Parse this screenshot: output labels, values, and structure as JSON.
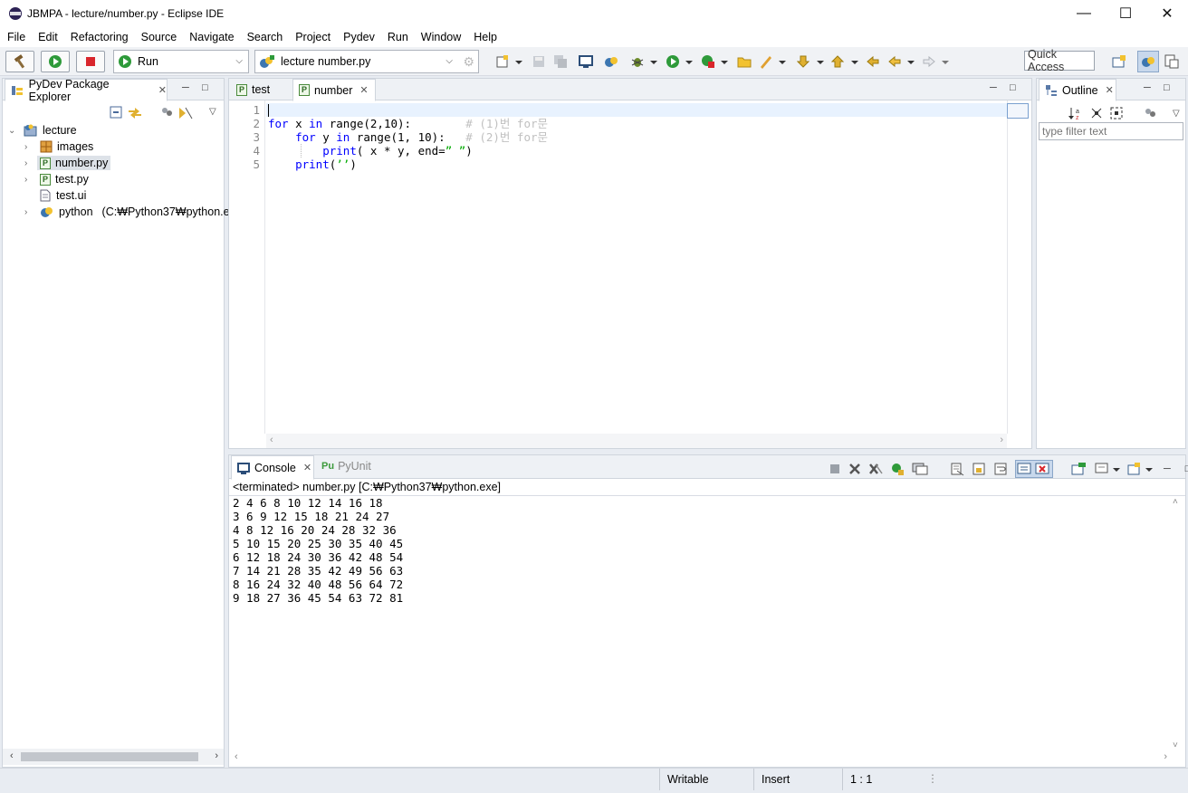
{
  "window": {
    "title": "JBMPA - lecture/number.py - Eclipse IDE"
  },
  "menu": [
    "File",
    "Edit",
    "Refactoring",
    "Source",
    "Navigate",
    "Search",
    "Project",
    "Pydev",
    "Run",
    "Window",
    "Help"
  ],
  "toolbar": {
    "run_config": "Run",
    "launch_target": "lecture number.py",
    "quick_access": "Quick Access"
  },
  "explorer": {
    "tab_label": "PyDev Package Explorer",
    "project": "lecture",
    "items": [
      "images",
      "number.py",
      "test.py",
      "test.ui"
    ],
    "interpreter": "python",
    "interpreter_path": "(C:₩Python37₩python.ex"
  },
  "editor": {
    "tabs": [
      "test",
      "number"
    ],
    "line_numbers": [
      "1",
      "2",
      "3",
      "4",
      "5"
    ]
  },
  "outline": {
    "tab_label": "Outline",
    "filter_placeholder": "type filter text"
  },
  "console": {
    "tab_label": "Console",
    "pyunit_label": "PyUnit",
    "header": "<terminated> number.py [C:₩Python37₩python.exe]",
    "lines": [
      "2 4 6 8 10 12 14 16 18",
      "3 6 9 12 15 18 21 24 27",
      "4 8 12 16 20 24 28 32 36",
      "5 10 15 20 25 30 35 40 45",
      "6 12 18 24 30 36 42 48 54",
      "7 14 21 28 35 42 49 56 63",
      "8 16 24 32 40 48 56 64 72",
      "9 18 27 36 45 54 63 72 81"
    ]
  },
  "status": {
    "writable": "Writable",
    "insert": "Insert",
    "position": "1 : 1"
  },
  "colors": {
    "keyword": "#0000ff",
    "comment": "#c0c0c0",
    "string": "#00aa00",
    "selection": "#dde2e8"
  }
}
